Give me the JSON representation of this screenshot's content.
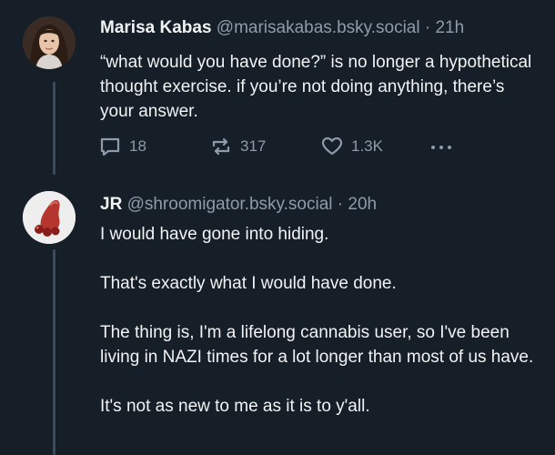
{
  "posts": [
    {
      "author_name": "Marisa Kabas",
      "handle": "@marisakabas.bsky.social",
      "time": "21h",
      "body": "“what would you have done?” is no longer a hypothetical thought exercise. if you’re not doing anything, there’s your answer.",
      "reply_count": "18",
      "repost_count": "317",
      "like_count": "1.3K"
    },
    {
      "author_name": "JR",
      "handle": "@shroomigator.bsky.social",
      "time": "20h",
      "paragraphs": [
        "I would have gone into hiding.",
        "That's exactly what I would have done.",
        "The thing is, I'm a lifelong cannabis user, so I've been living in NAZI times for a lot longer than most of us have.",
        "It's not as new to me as it is to y'all."
      ]
    }
  ],
  "separator": "·",
  "colors": {
    "background": "#161e27",
    "text": "#f1f3f5",
    "muted": "#8d9baa",
    "thread_line": "#3b4a5a"
  },
  "icons": [
    "reply-icon",
    "repost-icon",
    "like-icon",
    "more-options-icon"
  ]
}
